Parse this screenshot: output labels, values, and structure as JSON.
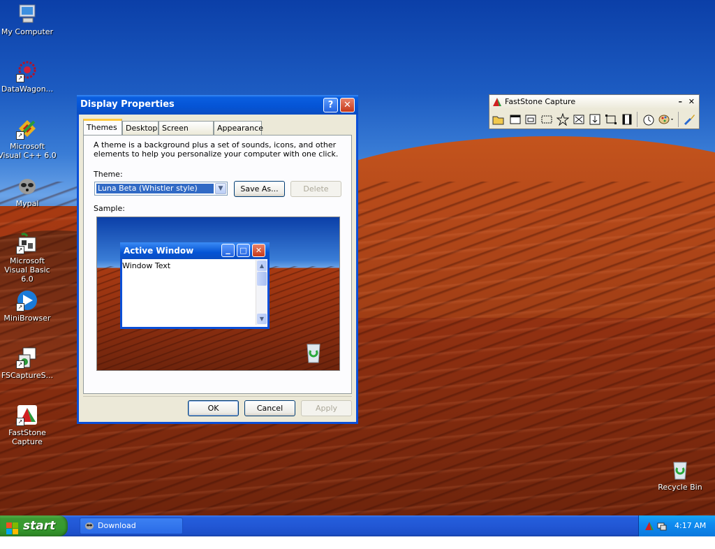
{
  "desktop_icons": [
    {
      "label": "My Computer"
    },
    {
      "label": "DataWagon..."
    },
    {
      "label": "Microsoft Visual C++ 6.0"
    },
    {
      "label": "Mypal"
    },
    {
      "label": "Microsoft Visual Basic 6.0"
    },
    {
      "label": "MiniBrowser"
    },
    {
      "label": "FSCaptureS..."
    },
    {
      "label": "FastStone Capture"
    },
    {
      "label": "Recycle Bin"
    }
  ],
  "display_dialog": {
    "title": "Display Properties",
    "tabs": [
      {
        "label": "Themes",
        "active": true
      },
      {
        "label": "Desktop"
      },
      {
        "label": "Screen Saver"
      },
      {
        "label": "Appearance"
      }
    ],
    "description": "A theme is a background plus a set of sounds, icons, and other elements to help you personalize your computer with one click.",
    "theme_label": "Theme:",
    "theme_value": "Luna Beta (Whistler style)",
    "save_as_label": "Save As...",
    "delete_label": "Delete",
    "sample_label": "Sample:",
    "sample_window_title": "Active Window",
    "sample_window_text": "Window Text",
    "ok_label": "OK",
    "cancel_label": "Cancel",
    "apply_label": "Apply"
  },
  "capture_toolbar": {
    "title": "FastStone Capture",
    "minimize_glyph": "–",
    "close_glyph": "✕"
  },
  "taskbar": {
    "start_label": "start",
    "task_label": "Download FastStone...",
    "clock": "4:17 AM"
  },
  "colors": {
    "xp_blue": "#0a4fd8",
    "start_green": "#3c9a32",
    "tray_blue": "#0f8bf0"
  }
}
